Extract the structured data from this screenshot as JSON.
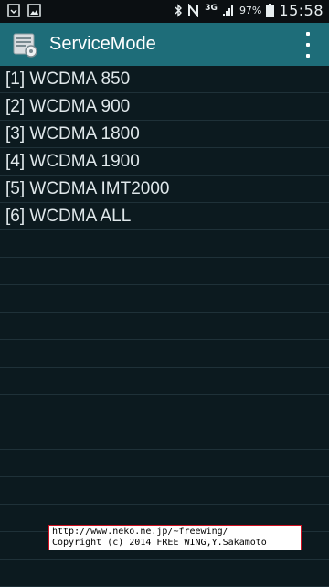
{
  "status_bar": {
    "network": "3G",
    "battery": "97%",
    "time": "15:58",
    "left_icons": [
      "download-icon",
      "image-icon"
    ],
    "right_icons": [
      "bluetooth-icon",
      "nfc-icon",
      "signal-icon",
      "battery-icon"
    ]
  },
  "action_bar": {
    "title": "ServiceMode",
    "menu_icon": "overflow-menu-icon"
  },
  "list": {
    "items": [
      "[1] WCDMA 850",
      "[2] WCDMA 900",
      "[3] WCDMA 1800",
      "[4] WCDMA 1900",
      "[5] WCDMA IMT2000",
      "[6] WCDMA ALL",
      "",
      "",
      "",
      "",
      "",
      "",
      "",
      "",
      "",
      "",
      "",
      "",
      ""
    ]
  },
  "credit": {
    "line1": "http://www.neko.ne.jp/~freewing/",
    "line2": "Copyright (c) 2014 FREE WING,Y.Sakamoto"
  },
  "colors": {
    "action_bar": "#1e6d79",
    "background": "#0c1a1f",
    "credit_border": "#d01020"
  }
}
